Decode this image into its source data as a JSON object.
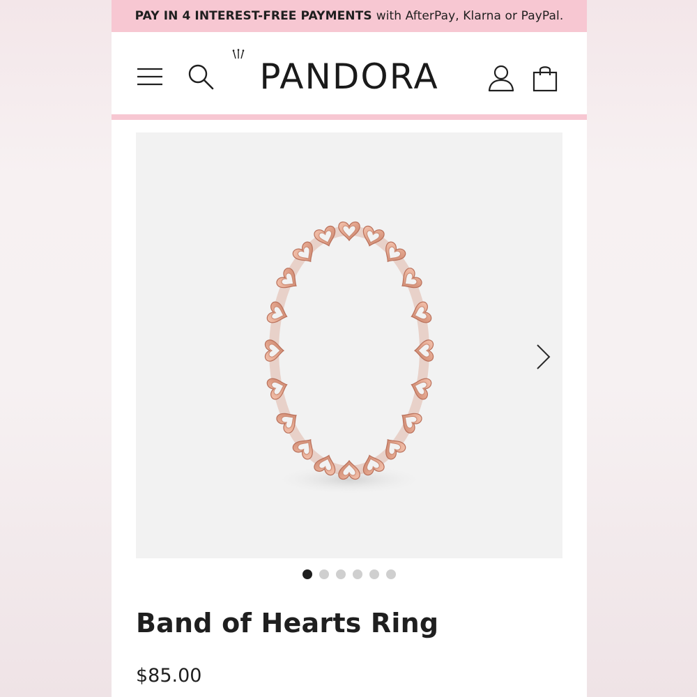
{
  "promo": {
    "bold": "PAY IN 4 INTEREST-FREE PAYMENTS",
    "rest": "with AfterPay, Klarna or PayPal."
  },
  "header": {
    "logo": "PANDORA",
    "icons": [
      "menu-icon",
      "search-icon",
      "account-icon",
      "shopping-bag-icon"
    ]
  },
  "gallery": {
    "image": "rose-gold band of hearts ring",
    "slide_count": 6,
    "active_slide": 1,
    "next_icon": "chevron-right-icon"
  },
  "product": {
    "title": "Band of Hearts Ring",
    "price": "$85.00"
  },
  "colors": {
    "promo_bg": "#f7c7d2",
    "ring_rose_gold": "#e0a189",
    "text": "#1f1f1f"
  }
}
